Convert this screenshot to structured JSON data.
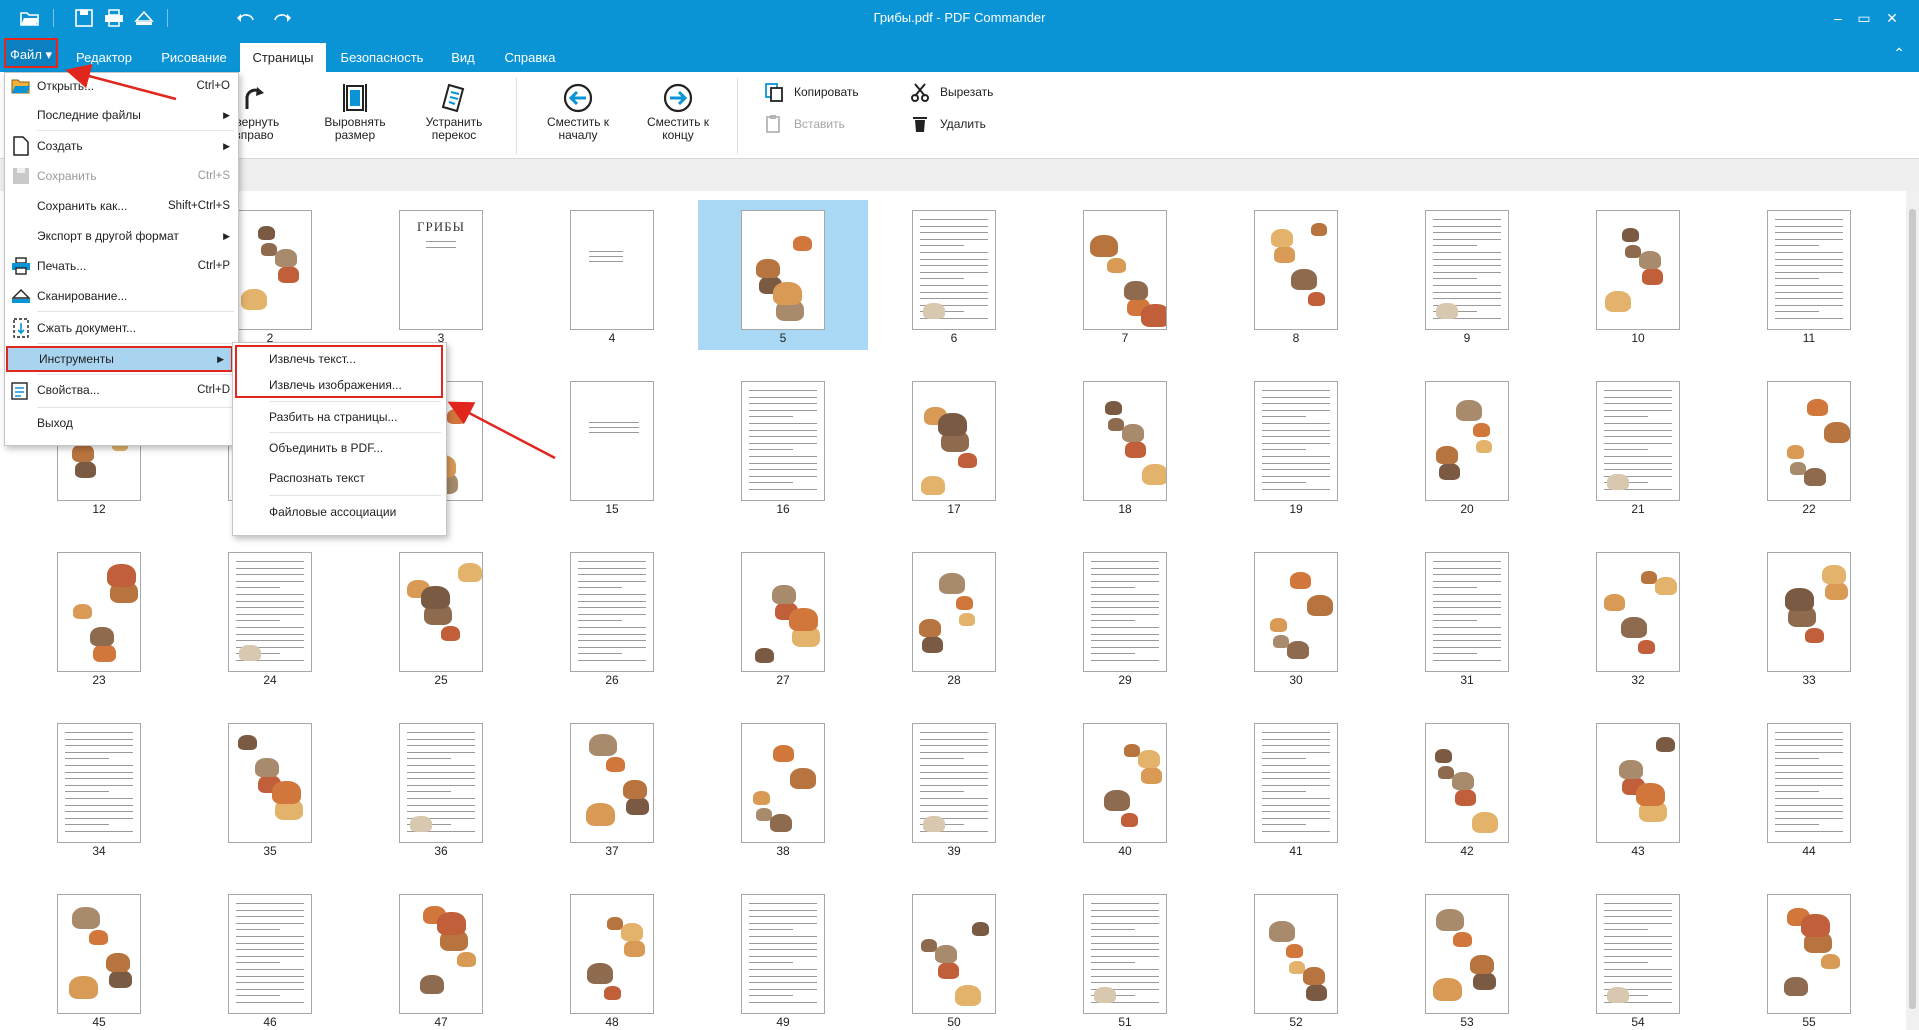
{
  "window": {
    "title": "Грибы.pdf - PDF Commander"
  },
  "quick_access": [
    {
      "name": "open-folder-icon"
    },
    {
      "name": "save-icon"
    },
    {
      "name": "print-icon"
    },
    {
      "name": "scan-icon"
    },
    {
      "name": "undo-icon"
    },
    {
      "name": "redo-icon"
    }
  ],
  "window_controls": {
    "minimize": "–",
    "maximize": "▭",
    "close": "✕"
  },
  "tabs": {
    "file": "Файл ▾",
    "editor": "Редактор",
    "drawing": "Рисование",
    "pages": "Страницы",
    "security": "Безопасность",
    "view": "Вид",
    "help": "Справка",
    "active": "Страницы",
    "collapse": "⌃"
  },
  "ribbon": {
    "rotate_right": "овернуть\nвправо",
    "align_size": "Выровнять\nразмер",
    "fix_skew": "Устранить\nперекос",
    "move_to_start": "Сместить к\nначалу",
    "move_to_end": "Сместить к\nконцу",
    "copy": "Копировать",
    "paste": "Вставить",
    "cut": "Вырезать",
    "delete": "Удалить"
  },
  "file_menu": {
    "items": [
      {
        "label": "Открыть...",
        "shortcut": "Ctrl+O",
        "icon": "open-folder-icon"
      },
      {
        "label": "Последние файлы",
        "arrow": "▶"
      },
      {
        "label": "Создать",
        "arrow": "▶",
        "icon": "new-document-icon"
      },
      {
        "label": "Сохранить",
        "shortcut": "Ctrl+S",
        "icon": "save-icon",
        "disabled": true
      },
      {
        "label": "Сохранить как...",
        "shortcut": "Shift+Ctrl+S"
      },
      {
        "label": "Экспорт в другой формат",
        "arrow": "▶"
      },
      {
        "label": "Печать...",
        "shortcut": "Ctrl+P",
        "icon": "print-icon"
      },
      {
        "label": "Сканирование...",
        "icon": "scan-icon"
      },
      {
        "label": "Сжать документ...",
        "icon": "compress-icon"
      },
      {
        "label": "Инструменты",
        "arrow": "▶",
        "highlighted": true
      },
      {
        "label": "Свойства...",
        "shortcut": "Ctrl+D",
        "icon": "properties-icon"
      },
      {
        "label": "Выход"
      }
    ]
  },
  "tools_submenu": {
    "items": [
      {
        "label": "Извлечь текст..."
      },
      {
        "label": "Извлечь изображения..."
      },
      {
        "label": "Разбить на страницы..."
      },
      {
        "label": "Объединить в PDF..."
      },
      {
        "label": "Распознать текст"
      },
      {
        "label": "Файловые ассоциации"
      }
    ]
  },
  "pages": {
    "selected": "5",
    "rows": [
      [
        "",
        "2",
        "3",
        "4",
        "5",
        "6",
        "7",
        "8",
        "9",
        "10",
        "11"
      ],
      [
        "12",
        "",
        "",
        "15",
        "16",
        "17",
        "18",
        "19",
        "20",
        "21",
        "22"
      ],
      [
        "23",
        "24",
        "25",
        "26",
        "27",
        "28",
        "29",
        "30",
        "31",
        "32",
        "33"
      ],
      [
        "34",
        "35",
        "36",
        "37",
        "38",
        "39",
        "40",
        "41",
        "42",
        "43",
        "44"
      ],
      [
        "45",
        "46",
        "47",
        "48",
        "49",
        "50",
        "51",
        "52",
        "53",
        "54",
        "55"
      ]
    ],
    "page3_title": "ГРИБЫ",
    "colors": {
      "selection": "#a8d8f3",
      "accent": "#0a94d6",
      "annotation": "#e0261d"
    }
  }
}
